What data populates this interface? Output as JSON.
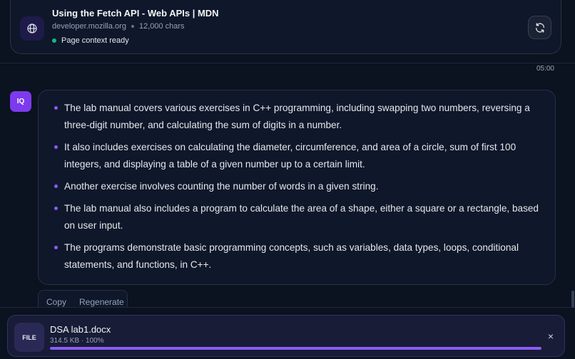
{
  "context": {
    "title": "Using the Fetch API - Web APIs | MDN",
    "domain": "developer.mozilla.org",
    "chars": "12,000 chars",
    "status": "Page context ready",
    "globe_icon": "globe-icon",
    "refresh_icon": "refresh-icon"
  },
  "message": {
    "timestamp": "05:00",
    "avatar": "IQ",
    "bullets": [
      "The lab manual covers various exercises in C++ programming, including swapping two numbers, reversing a three-digit number, and calculating the sum of digits in a number.",
      "It also includes exercises on calculating the diameter, circumference, and area of a circle, sum of first 100 integers, and displaying a table of a given number up to a certain limit.",
      "Another exercise involves counting the number of words in a given string.",
      "The lab manual also includes a program to calculate the area of a shape, either a square or a rectangle, based on user input.",
      "The programs demonstrate basic programming concepts, such as variables, data types, loops, conditional statements, and functions, in C++."
    ]
  },
  "actions": {
    "copy": "Copy",
    "regenerate": "Regenerate"
  },
  "file": {
    "badge": "FILE",
    "name": "DSA lab1.docx",
    "meta": "314.5 KB · 100%",
    "progress": 1.0,
    "close": "×"
  },
  "colors": {
    "accent": "#8b5cf6",
    "avatar": "#7c3aed",
    "status_ok": "#10b981",
    "background": "#0b1220"
  }
}
